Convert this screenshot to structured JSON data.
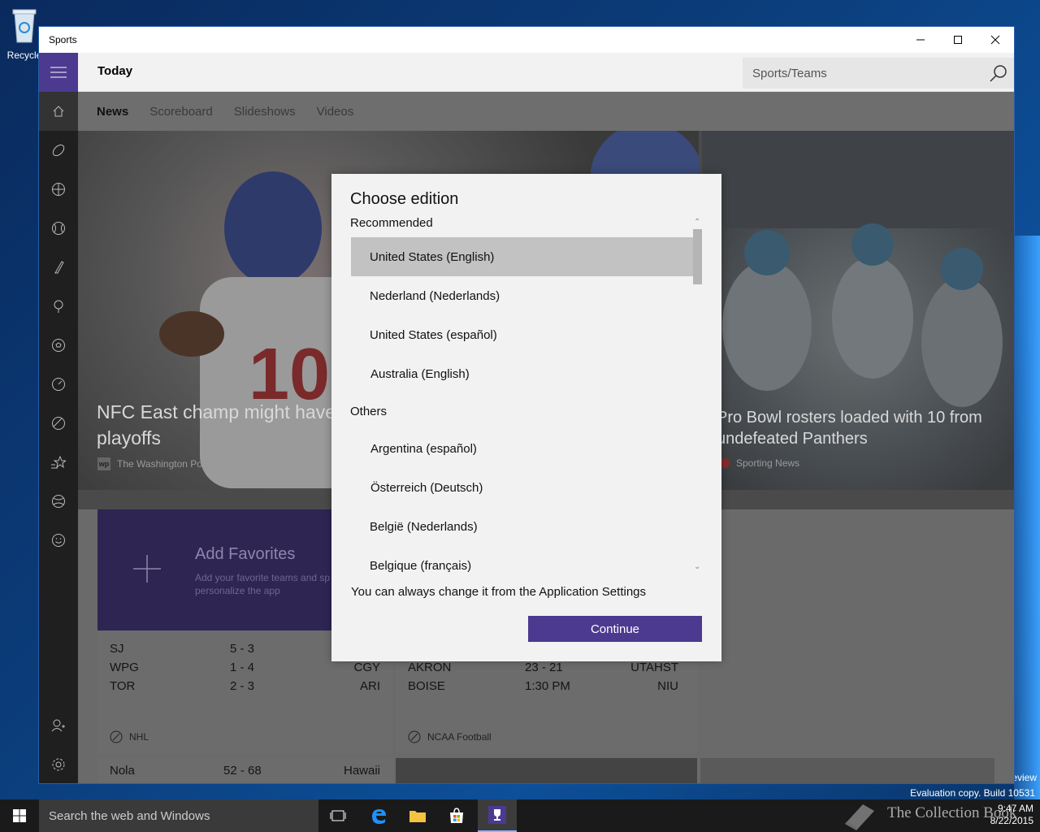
{
  "desktop": {
    "recycle_bin_label": "Recycle",
    "watermark_line1": "Evaluation copy. Build 10531",
    "watermark_partial": "eview"
  },
  "window": {
    "title": "Sports"
  },
  "header": {
    "page_title": "Today",
    "search_placeholder": "Sports/Teams"
  },
  "subnav": {
    "tabs": [
      {
        "label": "News",
        "active": true
      },
      {
        "label": "Scoreboard",
        "active": false
      },
      {
        "label": "Slideshows",
        "active": false
      },
      {
        "label": "Videos",
        "active": false
      }
    ]
  },
  "sidebar": {
    "icons": [
      "home-icon",
      "football-icon",
      "basketball-icon",
      "baseball-icon",
      "hockey-icon",
      "golf-icon",
      "soccer-icon",
      "racing-icon",
      "tennis-icon",
      "favorites-icon",
      "sports-ball-icon",
      "smiley-icon",
      "account-icon",
      "settings-icon"
    ]
  },
  "hero": {
    "left": {
      "title_line1": "NFC East champ might have",
      "title_line2": "playoffs",
      "source_badge": "wp",
      "source": "The Washington Post"
    },
    "right": {
      "title_line1": "Pro Bowl rosters loaded with 10 from",
      "title_line2": "undefeated Panthers",
      "source": "Sporting News"
    }
  },
  "favorites": {
    "title": "Add Favorites",
    "subtitle_line1": "Add your favorite teams and sp",
    "subtitle_line2": "personalize the app"
  },
  "scores": {
    "nhl": {
      "league": "NHL",
      "rows": [
        {
          "home": "SJ",
          "score": "5  -  3",
          "away": ""
        },
        {
          "home": "WPG",
          "score": "1  -  4",
          "away": "CGY"
        },
        {
          "home": "TOR",
          "score": "2  -  3",
          "away": "ARI"
        }
      ]
    },
    "ncaa": {
      "league": "NCAA Football",
      "rows": [
        {
          "home": "AKRON",
          "score": "23  -  21",
          "away": "UTAHST"
        },
        {
          "home": "BOISE",
          "score": "1:30 PM",
          "away": "NIU"
        }
      ]
    },
    "bottom": {
      "home": "Nola",
      "score": "52  -  68",
      "away": "Hawaii"
    }
  },
  "dialog": {
    "title": "Choose edition",
    "recommended_label": "Recommended",
    "recommended": [
      {
        "label": "United States (English)",
        "selected": true
      },
      {
        "label": "Nederland (Nederlands)",
        "selected": false
      },
      {
        "label": "United States (español)",
        "selected": false
      },
      {
        "label": "Australia (English)",
        "selected": false
      }
    ],
    "others_label": "Others",
    "others": [
      {
        "label": "Argentina (español)"
      },
      {
        "label": "Österreich (Deutsch)"
      },
      {
        "label": "België (Nederlands)"
      },
      {
        "label": "Belgique (français)"
      }
    ],
    "note": "You can always change it from the Application Settings",
    "continue_label": "Continue"
  },
  "taskbar": {
    "search_placeholder": "Search the web and Windows",
    "time": "9:47 AM",
    "date": "8/22/2015",
    "watermark_brand": "The Collection Book"
  },
  "colors": {
    "accent": "#4b3a8f",
    "selected_item": "#c2c2c2",
    "dialog_bg": "#f2f2f2"
  }
}
